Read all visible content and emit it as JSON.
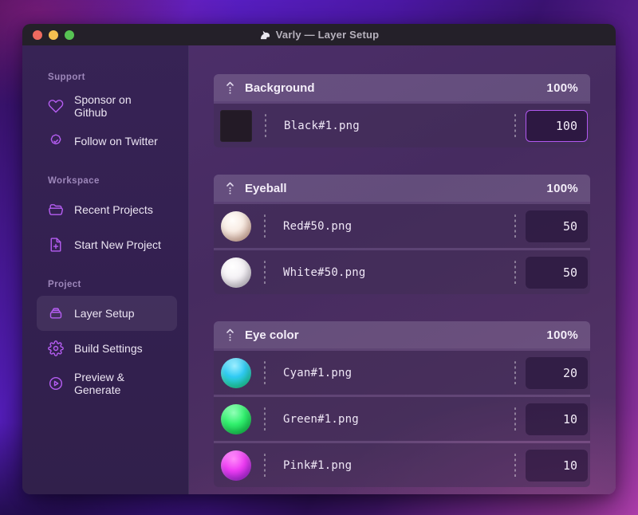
{
  "window": {
    "title": "Varly — Layer Setup",
    "traffic_lights": {
      "close": "close",
      "minimize": "minimize",
      "zoom": "zoom"
    },
    "app_icon": "unicorn-emoji"
  },
  "sidebar": {
    "sections": [
      {
        "label": "Support",
        "items": [
          {
            "icon": "heart-icon",
            "label": "Sponsor on Github"
          },
          {
            "icon": "badge-check-icon",
            "label": "Follow on Twitter"
          }
        ]
      },
      {
        "label": "Workspace",
        "items": [
          {
            "icon": "folder-open-icon",
            "label": "Recent Projects"
          },
          {
            "icon": "document-plus-icon",
            "label": "Start New Project"
          }
        ]
      },
      {
        "label": "Project",
        "items": [
          {
            "icon": "layers-box-icon",
            "label": "Layer Setup",
            "selected": true
          },
          {
            "icon": "gear-icon",
            "label": "Build Settings"
          },
          {
            "icon": "play-circle-icon",
            "label": "Preview & Generate"
          }
        ]
      }
    ]
  },
  "main": {
    "groups": [
      {
        "name": "Background",
        "weight": "100%",
        "layers": [
          {
            "thumb": "black-swatch",
            "file": "Black#1.png",
            "value": "100",
            "focused": true
          }
        ]
      },
      {
        "name": "Eyeball",
        "weight": "100%",
        "layers": [
          {
            "thumb": "red-ball",
            "file": "Red#50.png",
            "value": "50"
          },
          {
            "thumb": "white-ball",
            "file": "White#50.png",
            "value": "50"
          }
        ]
      },
      {
        "name": "Eye color",
        "weight": "100%",
        "layers": [
          {
            "thumb": "cyan-ball",
            "file": "Cyan#1.png",
            "value": "20"
          },
          {
            "thumb": "green-ball",
            "file": "Green#1.png",
            "value": "10"
          },
          {
            "thumb": "pink-ball",
            "file": "Pink#1.png",
            "value": "10"
          }
        ]
      }
    ]
  },
  "colors": {
    "accent_purple": "#b55df2",
    "focus_border": "#b158f0",
    "titlebar": "#242029",
    "sidebar_bg": "#342150",
    "content_bg": "#4c2e69",
    "traffic_close": "#ee6a5f",
    "traffic_min": "#f4bf50",
    "traffic_zoom": "#57c353"
  }
}
